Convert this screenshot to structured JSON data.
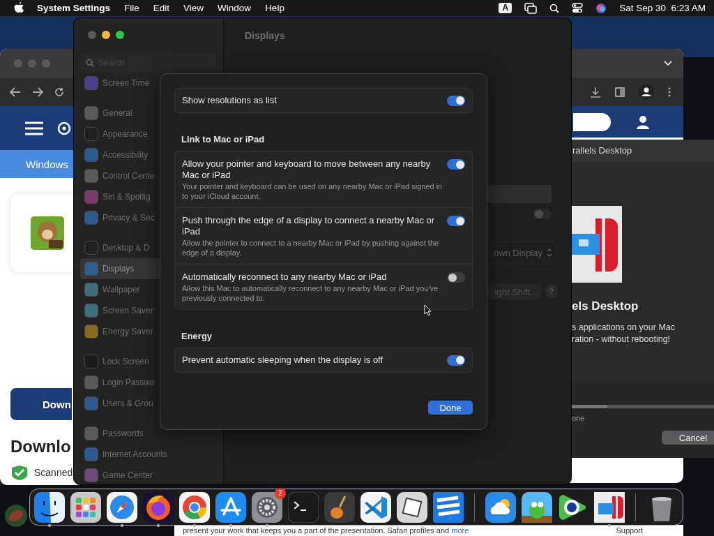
{
  "menubar": {
    "app": "System Settings",
    "menus": [
      "File",
      "Edit",
      "View",
      "Window",
      "Help"
    ],
    "input_source": "A",
    "clock": "Sat Sep 30  6:23 AM"
  },
  "browser_left": {
    "nav_tab": "Windows",
    "button": "Down",
    "heading": "Downlo",
    "scan_note": "Scanned"
  },
  "parallels": {
    "title": "rallels Desktop",
    "heading": "els Desktop",
    "lines": [
      "s applications on your Mac",
      "ration - without rebooting!"
    ],
    "progress": {
      "level": 0.22
    },
    "status": "one",
    "cancel": "Cancel"
  },
  "settings": {
    "search_placeholder": "Search",
    "title": "Displays",
    "sidebar": [
      [
        {
          "label": "Screen Time",
          "color": "#4b3f8e",
          "selected": false
        }
      ],
      [
        {
          "label": "General",
          "color": "#5a5a5a",
          "selected": false
        },
        {
          "label": "Appearance",
          "color": "#202020",
          "selected": false
        },
        {
          "label": "Accessibility",
          "color": "#2b5a8f",
          "selected": false
        },
        {
          "label": "Control Cente",
          "color": "#5a5a5a",
          "selected": false
        },
        {
          "label": "Siri & Spotlig",
          "color": "#7a3a6a",
          "selected": false
        },
        {
          "label": "Privacy & Sec",
          "color": "#2f5a8f",
          "selected": false
        }
      ],
      [
        {
          "label": "Desktop & D",
          "color": "#222222",
          "selected": false
        },
        {
          "label": "Displays",
          "color": "#2e5f8f",
          "selected": true
        },
        {
          "label": "Wallpaper",
          "color": "#3d6f7f",
          "selected": false
        },
        {
          "label": "Screen Saver",
          "color": "#3f6f78",
          "selected": false
        },
        {
          "label": "Energy Saver",
          "color": "#8a6a20",
          "selected": false
        }
      ],
      [
        {
          "label": "Lock Screen",
          "color": "#1a1a1a",
          "selected": false
        },
        {
          "label": "Login Passwo",
          "color": "#5a5a5a",
          "selected": false
        },
        {
          "label": "Users & Grou",
          "color": "#2f5a8f",
          "selected": false
        }
      ],
      [
        {
          "label": "Passwords",
          "color": "#5a5a5a",
          "selected": false
        },
        {
          "label": "Internet Accounts",
          "color": "#2f5a8f",
          "selected": false
        },
        {
          "label": "Game Center",
          "color": "#6a4a7a",
          "selected": false
        }
      ]
    ],
    "behind": {
      "toggle_on": false,
      "display_select": "own Display",
      "night_shift": "ight Shift...",
      "help": "?"
    }
  },
  "sheet": {
    "top_row": {
      "label": "Show resolutions as list",
      "on": true
    },
    "sections": [
      {
        "title": "Link to Mac or iPad",
        "rows": [
          {
            "label": "Allow your pointer and keyboard to move between any nearby Mac or iPad",
            "description": "Your pointer and keyboard can be used on any nearby Mac or iPad signed in to your iCloud account.",
            "on": true
          },
          {
            "label": "Push through the edge of a display to connect a nearby Mac or iPad",
            "description": "Allow the pointer to connect to a nearby Mac or iPad by pushing against the edge of a display.",
            "on": true
          },
          {
            "label": "Automatically reconnect to any nearby Mac or iPad",
            "description": "Allow this Mac to automatically reconnect to any nearby Mac or iPad you've previously connected to.",
            "on": false
          }
        ]
      },
      {
        "title": "Energy",
        "rows": [
          {
            "label": "Prevent automatic sleeping when the display is off",
            "on": true
          }
        ]
      }
    ],
    "done": "Done"
  },
  "dock": {
    "items": [
      {
        "kind": "finder",
        "running": true
      },
      {
        "kind": "launchpad",
        "running": false
      },
      {
        "kind": "safari",
        "running": true
      },
      {
        "kind": "firefox",
        "running": true
      },
      {
        "kind": "chrome",
        "running": true
      },
      {
        "kind": "appstore",
        "running": true
      },
      {
        "kind": "settings",
        "running": true,
        "badge": "2"
      },
      {
        "kind": "terminal",
        "running": false
      },
      {
        "kind": "guitar",
        "running": false
      },
      {
        "kind": "vscode",
        "running": false
      },
      {
        "kind": "blocks",
        "running": false
      },
      {
        "kind": "stripes",
        "running": false
      },
      {
        "kind": "separator"
      },
      {
        "kind": "weather",
        "running": false
      },
      {
        "kind": "creature",
        "running": false
      },
      {
        "kind": "eye",
        "running": false
      },
      {
        "kind": "parallels",
        "running": true
      },
      {
        "kind": "separator"
      },
      {
        "kind": "trash",
        "running": false
      }
    ]
  },
  "page_footer": {
    "text": "present your work that keeps you a part of the presentation. Safari profiles and",
    "link": "more",
    "support": "Support"
  }
}
